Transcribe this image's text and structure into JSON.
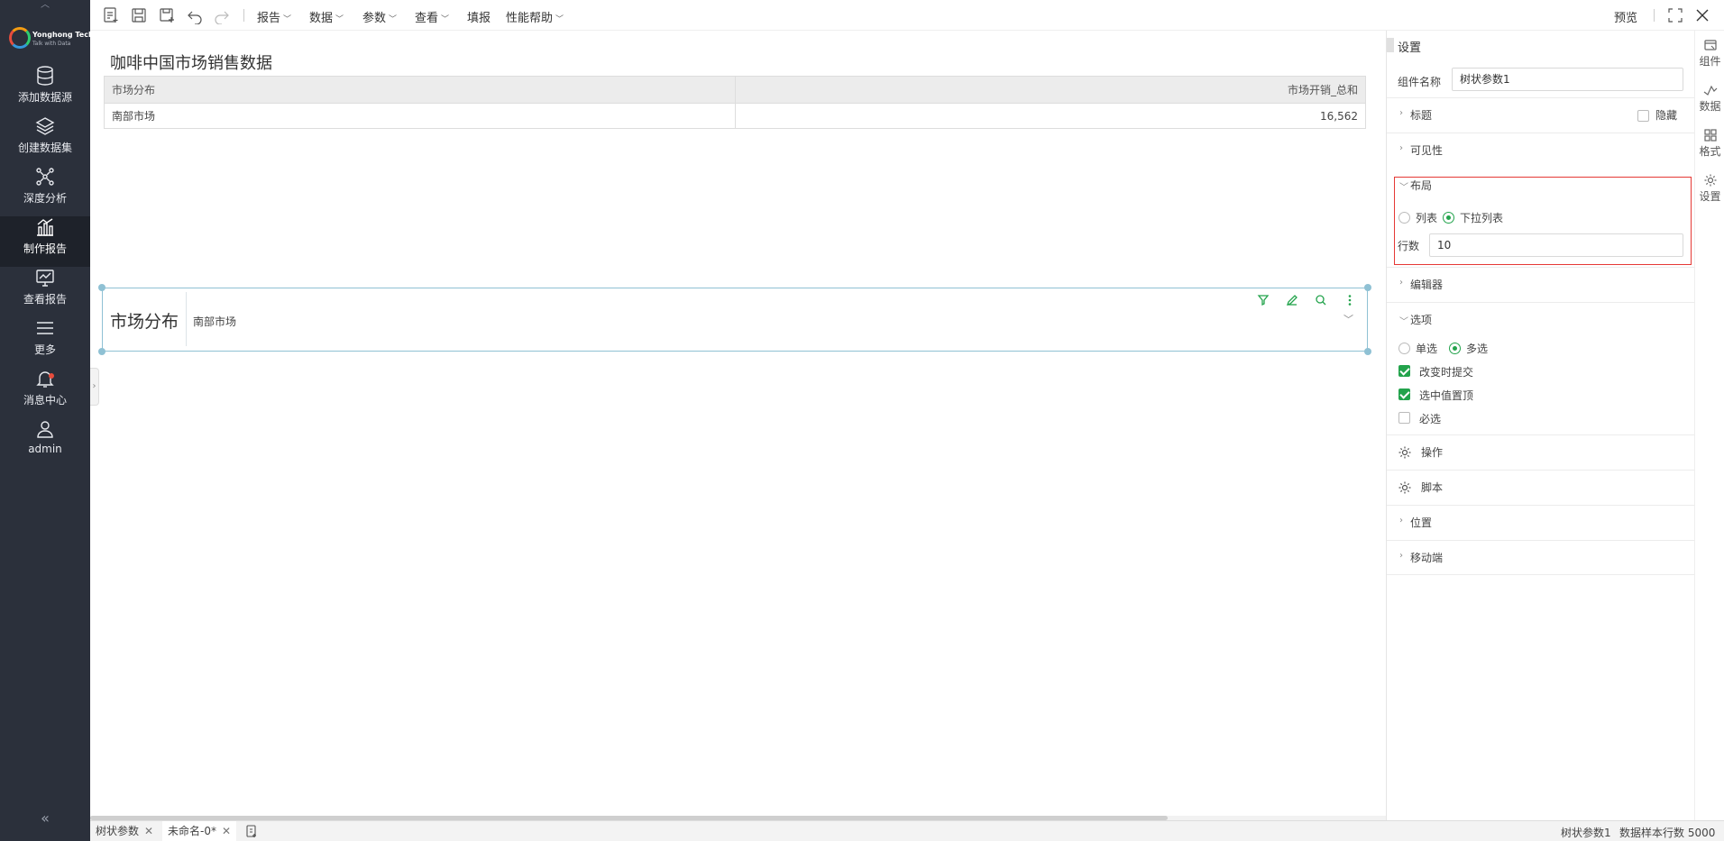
{
  "sidebar": {
    "logo": {
      "name": "Yonghong Tech",
      "tagline": "Talk with Data"
    },
    "items": [
      {
        "label": "添加数据源"
      },
      {
        "label": "创建数据集"
      },
      {
        "label": "深度分析"
      },
      {
        "label": "制作报告",
        "active": true
      },
      {
        "label": "查看报告"
      },
      {
        "label": "更多"
      },
      {
        "label": "消息中心",
        "badge": true
      },
      {
        "label": "admin"
      }
    ]
  },
  "toolbar": {
    "menus": [
      "报告",
      "数据",
      "参数",
      "查看",
      "填报",
      "性能帮助"
    ],
    "preview": "预览"
  },
  "canvas": {
    "report_title": "咖啡中国市场销售数据",
    "table": {
      "headers": [
        "市场分布",
        "市场开销_总和"
      ],
      "rows": [
        [
          "南部市场",
          "16,562"
        ]
      ]
    },
    "tree_param": {
      "caption": "市场分布",
      "value": "南部市场"
    }
  },
  "panel": {
    "title": "设置",
    "component_name_label": "组件名称",
    "component_name_value": "树状参数1",
    "sections": {
      "title": "标题",
      "hide_label": "隐藏",
      "visibility": "可见性",
      "layout": "布局",
      "layout_list": "列表",
      "layout_dropdown": "下拉列表",
      "rows_label": "行数",
      "rows_value": "10",
      "editor": "编辑器",
      "options": "选项",
      "single": "单选",
      "multi": "多选",
      "submit_on_change": "改变时提交",
      "pin_selected": "选中值置顶",
      "required": "必选",
      "operation": "操作",
      "script": "脚本",
      "position": "位置",
      "mobile": "移动端"
    }
  },
  "vtabs": [
    "组件",
    "数据",
    "格式",
    "设置"
  ],
  "bottom": {
    "tabs": [
      "树状参数",
      "未命名-0*"
    ],
    "status_component": "树状参数1",
    "status_rows": "数据样本行数 5000"
  },
  "colors": {
    "accent": "#23a34c",
    "sidebar_bg": "#2b303b",
    "highlight": "#e53935"
  }
}
